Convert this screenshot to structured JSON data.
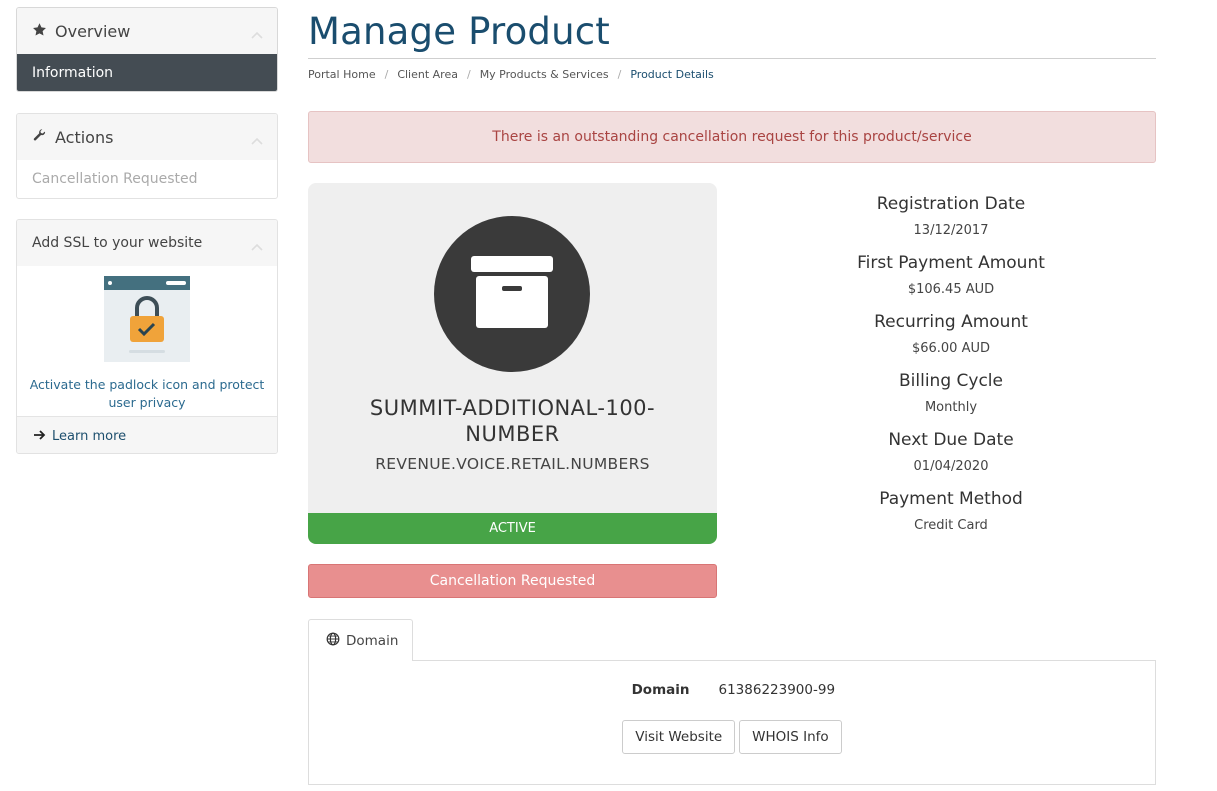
{
  "sidebar": {
    "overview": {
      "title": "Overview",
      "item": "Information"
    },
    "actions": {
      "title": "Actions",
      "item": "Cancellation Requested"
    },
    "ssl": {
      "title": "Add SSL to your website",
      "text": "Activate the padlock icon and protect user privacy",
      "learn_more": "Learn more"
    }
  },
  "header": {
    "title": "Manage Product",
    "breadcrumb": [
      "Portal Home",
      "Client Area",
      "My Products & Services",
      "Product Details"
    ]
  },
  "alert": "There is an outstanding cancellation request for this product/service",
  "product": {
    "name": "SUMMIT-ADDITIONAL-100-NUMBER",
    "group": "REVENUE.VOICE.RETAIL.NUMBERS",
    "status": "ACTIVE",
    "cancel_label": "Cancellation Requested"
  },
  "details": [
    {
      "label": "Registration Date",
      "value": "13/12/2017"
    },
    {
      "label": "First Payment Amount",
      "value": "$106.45 AUD"
    },
    {
      "label": "Recurring Amount",
      "value": "$66.00 AUD"
    },
    {
      "label": "Billing Cycle",
      "value": "Monthly"
    },
    {
      "label": "Next Due Date",
      "value": "01/04/2020"
    },
    {
      "label": "Payment Method",
      "value": "Credit Card"
    }
  ],
  "domain_tab": {
    "tab_label": "Domain",
    "label": "Domain",
    "value": "61386223900-99",
    "visit_label": "Visit Website",
    "whois_label": "WHOIS Info"
  },
  "colors": {
    "primary": "#1a4d6e",
    "sidebar_active": "#444c53",
    "alert_bg": "#f2dede",
    "alert_text": "#a94442",
    "status_active": "#47a447",
    "cancel_btn": "#e88f8f"
  }
}
